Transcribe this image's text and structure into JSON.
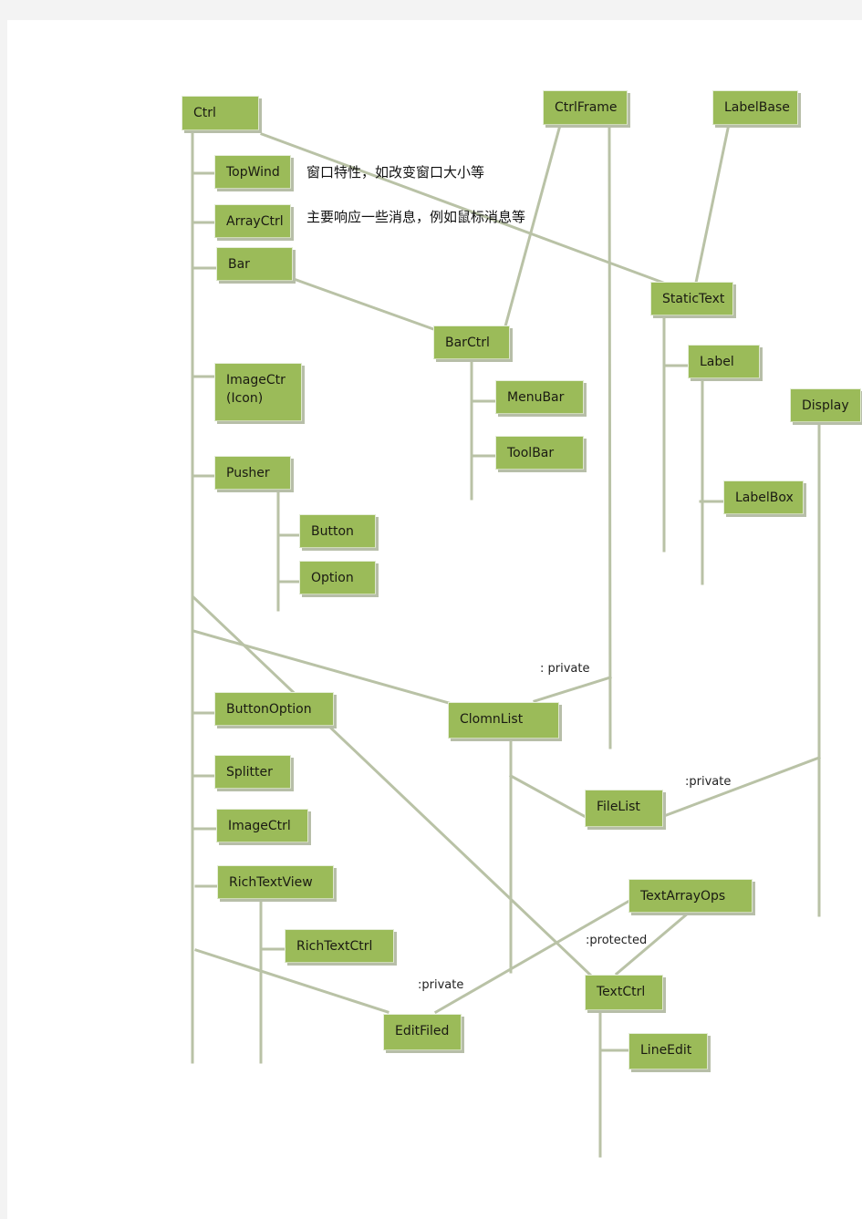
{
  "diagram": {
    "type": "class-inheritance-tree",
    "colors": {
      "node_fill": "#9bbb59",
      "wire": "#b9c2a6",
      "page": "#ffffff",
      "background": "#f3f3f3"
    },
    "nodes": [
      {
        "id": "ctrl",
        "label": "Ctrl"
      },
      {
        "id": "ctrlframe",
        "label": "CtrlFrame"
      },
      {
        "id": "labelbase",
        "label": "LabelBase"
      },
      {
        "id": "topwind",
        "label": "TopWind"
      },
      {
        "id": "arrayctrl",
        "label": "ArrayCtrl"
      },
      {
        "id": "bar",
        "label": "Bar"
      },
      {
        "id": "statictext",
        "label": "StaticText"
      },
      {
        "id": "barctrl",
        "label": "BarCtrl"
      },
      {
        "id": "label",
        "label": "Label"
      },
      {
        "id": "imagectr",
        "label": "ImageCtr\n(Icon)"
      },
      {
        "id": "menubar",
        "label": "MenuBar"
      },
      {
        "id": "display",
        "label": "Display"
      },
      {
        "id": "toolbar",
        "label": "ToolBar"
      },
      {
        "id": "pusher",
        "label": "Pusher"
      },
      {
        "id": "labelbox",
        "label": "LabelBox"
      },
      {
        "id": "button",
        "label": "Button"
      },
      {
        "id": "option",
        "label": "Option"
      },
      {
        "id": "buttonoption",
        "label": "ButtonOption"
      },
      {
        "id": "clomnlist",
        "label": "ClomnList"
      },
      {
        "id": "splitter",
        "label": "Splitter"
      },
      {
        "id": "filelist",
        "label": "FileList"
      },
      {
        "id": "imagectrl",
        "label": "ImageCtrl"
      },
      {
        "id": "richtextview",
        "label": "RichTextView"
      },
      {
        "id": "textarrayops",
        "label": "TextArrayOps"
      },
      {
        "id": "richtextctrl",
        "label": "RichTextCtrl"
      },
      {
        "id": "textctrl",
        "label": "TextCtrl"
      },
      {
        "id": "editfiled",
        "label": "EditFiled"
      },
      {
        "id": "lineedit",
        "label": "LineEdit"
      }
    ],
    "notes": {
      "topwind": "窗口特性，如改变窗口大小等",
      "arrayctrl": "主要响应一些消息，例如鼠标消息等"
    },
    "modifiers": {
      "clomnlist_ctrlframe": ":  private",
      "filelist_display": ":private",
      "textctrl_textarrayops": ":protected",
      "editfiled_textarrayops": ":private"
    }
  }
}
